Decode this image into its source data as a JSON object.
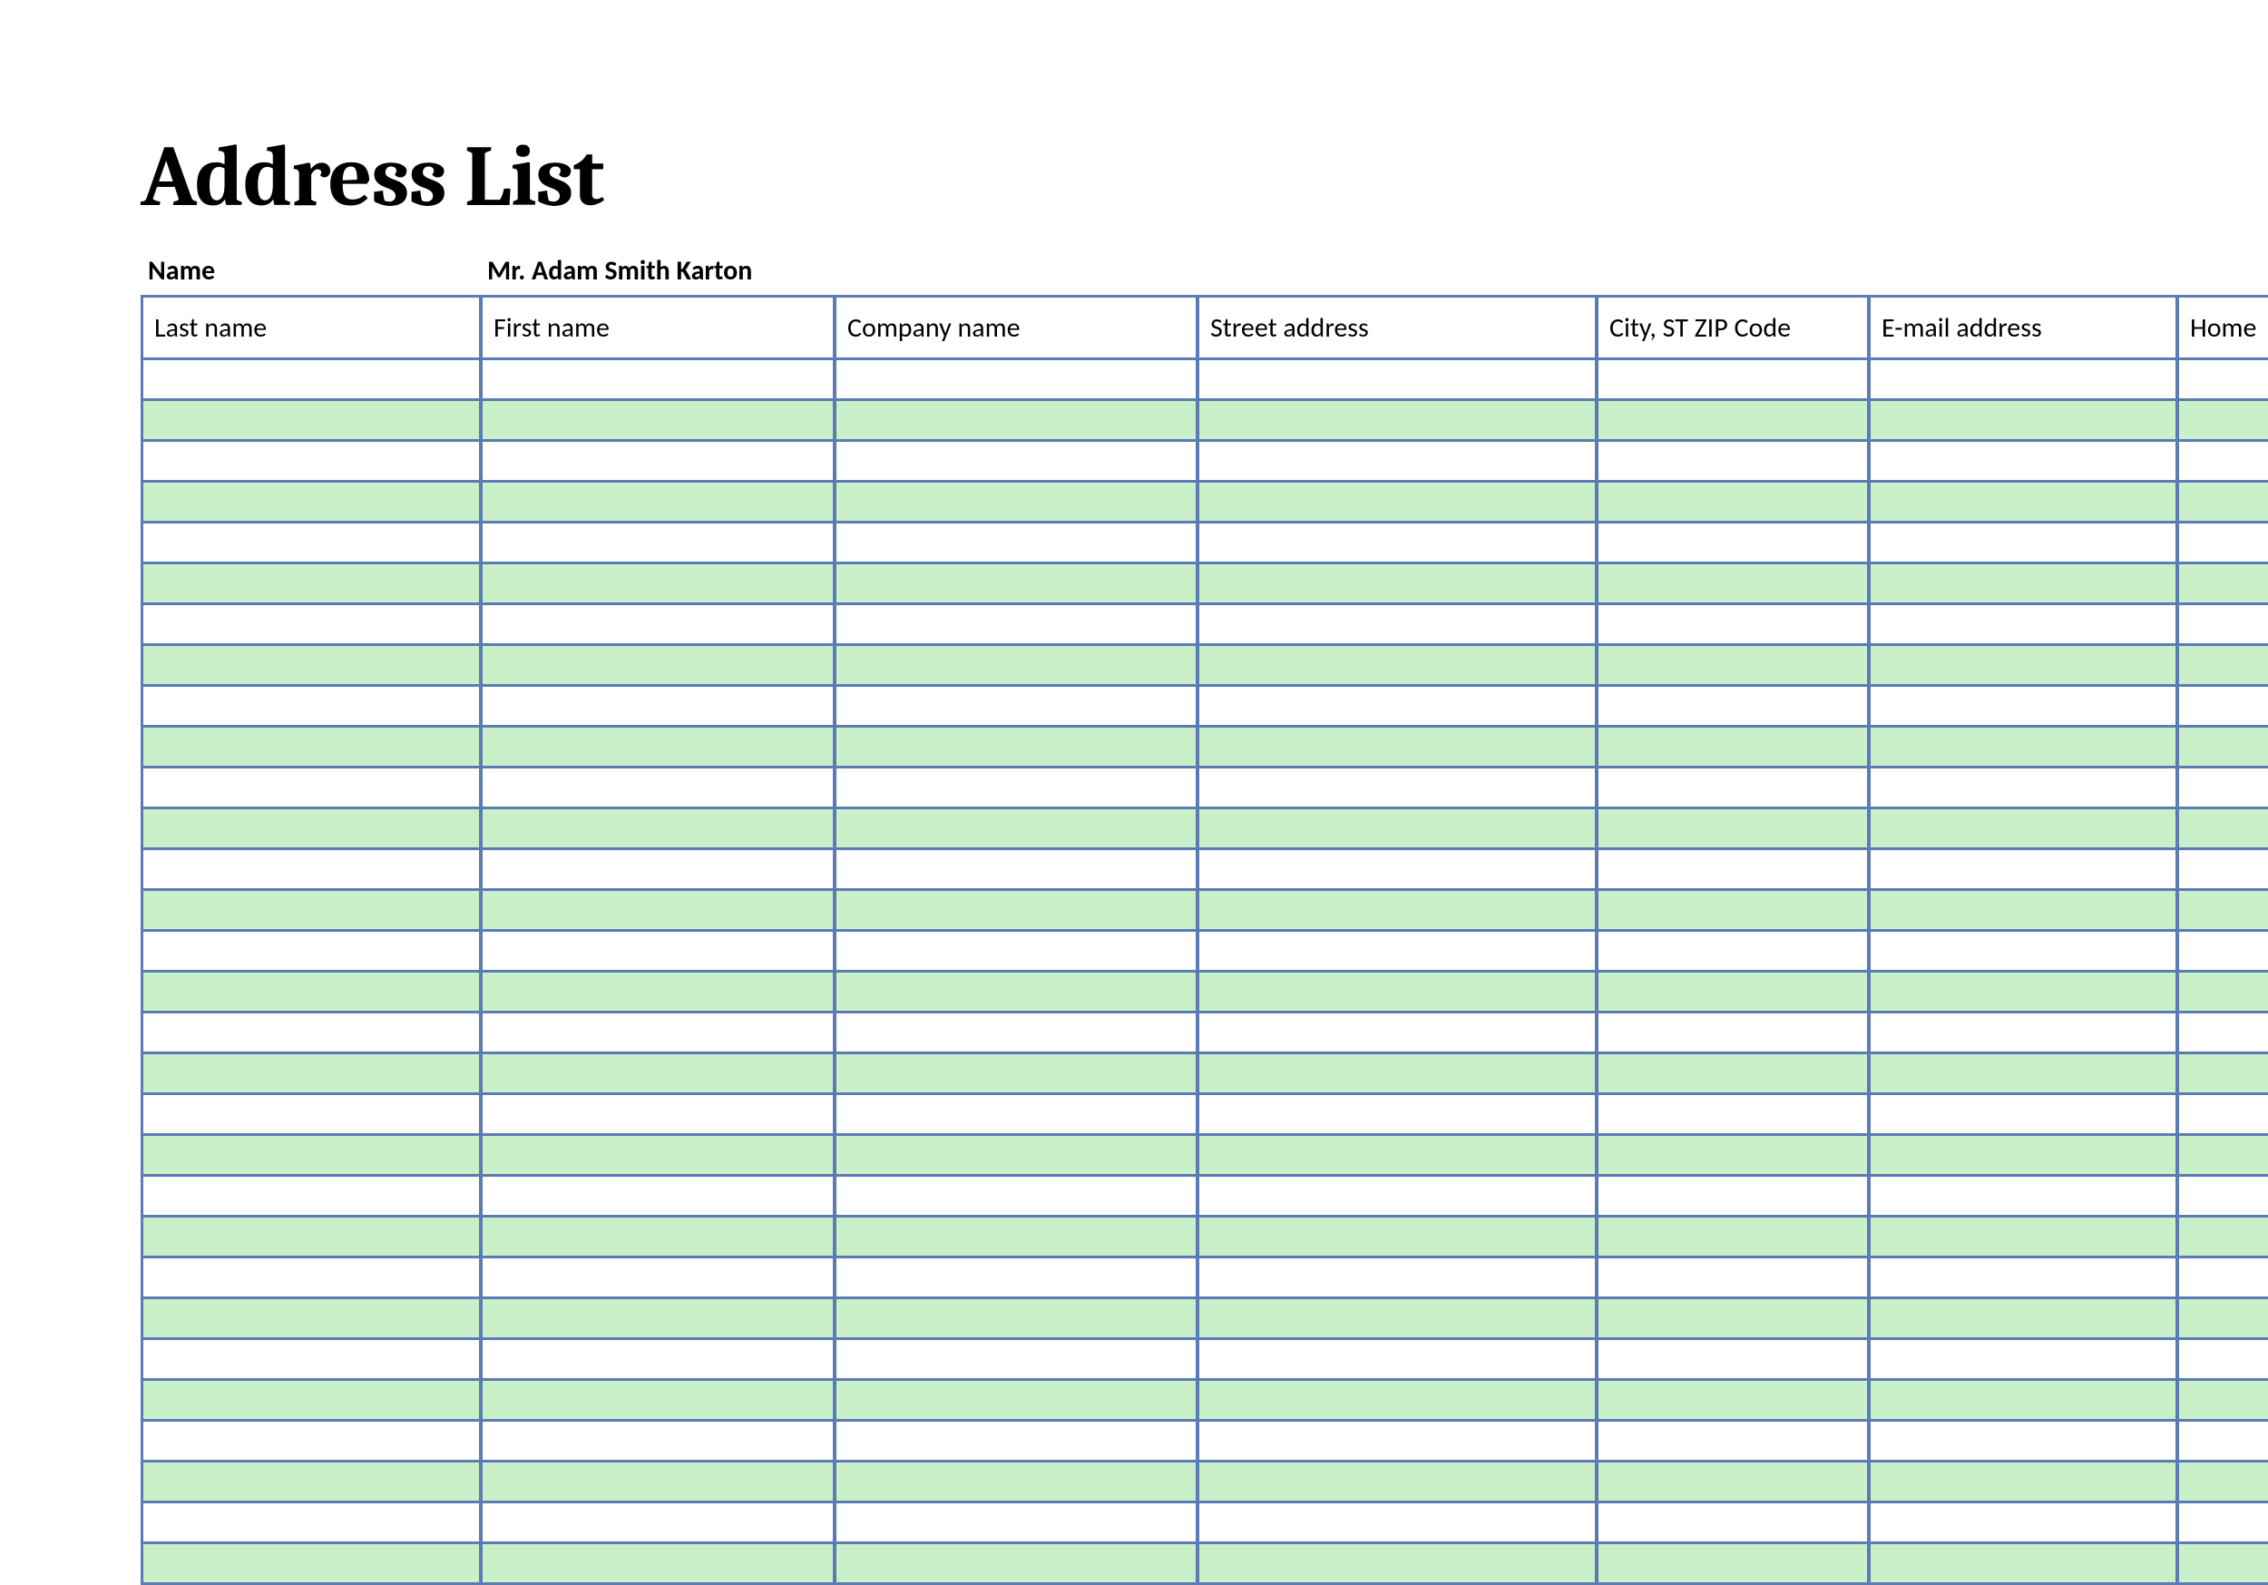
{
  "title": "Address List",
  "meta": {
    "label": "Name",
    "value": "Mr. Adam Smith Karton"
  },
  "columns": [
    "Last name",
    "First name",
    "Company name",
    "Street address",
    "City, ST  ZIP Code",
    "E-mail address",
    "Home"
  ],
  "row_count": 30,
  "colors": {
    "grid_border": "#5b7bb5",
    "alt_row": "#c9f0c9"
  }
}
